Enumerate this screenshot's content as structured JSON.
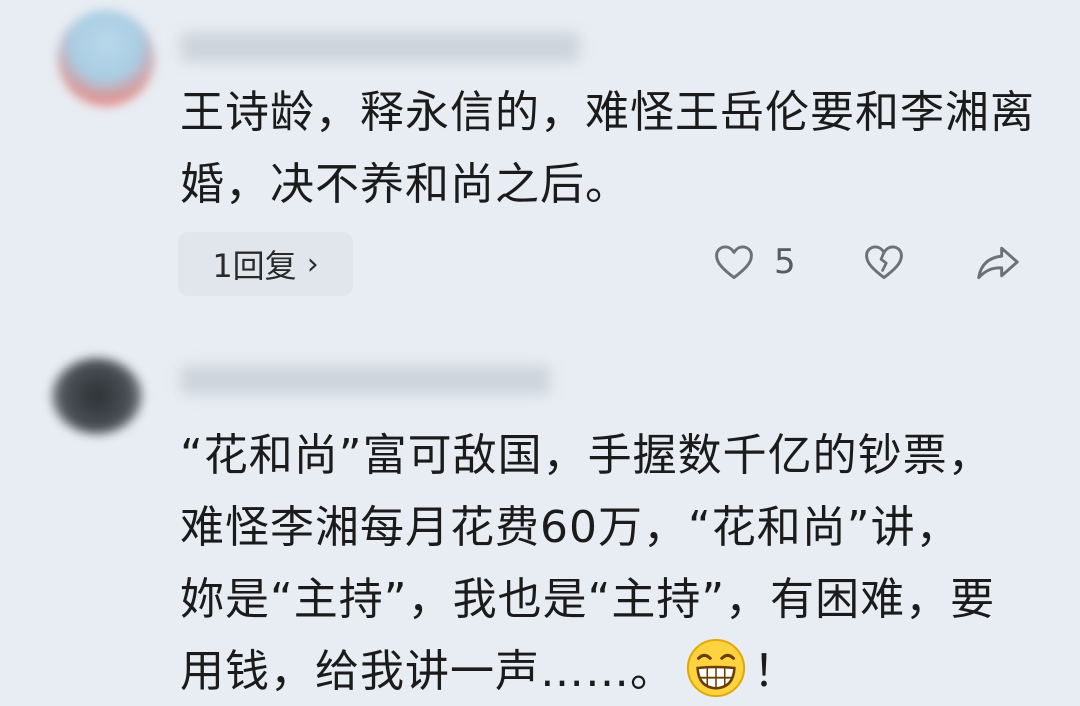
{
  "comments": [
    {
      "text": "王诗龄，释永信的，难怪王岳伦要和李湘离婚，决不养和尚之后。",
      "reply_label": "1回复",
      "reply_chevron": "›",
      "like_count": "5",
      "icons": [
        "heart-outline-icon",
        "broken-heart-icon",
        "share-arrow-icon"
      ]
    },
    {
      "text": "“花和尚”富可敌国，手握数千亿的钞票，难怪李湘每月花费60万，“花和尚”讲，妳是“主持”，我也是“主持”，有困难，要用钱，给我讲一声……。",
      "text_tail": "！",
      "emoji": "grinning-face-emoji"
    }
  ],
  "colors": {
    "background": "#e8edf3",
    "text": "#1b1b1b",
    "icon": "#6b7178",
    "emoji_face": "#ffd23f"
  }
}
